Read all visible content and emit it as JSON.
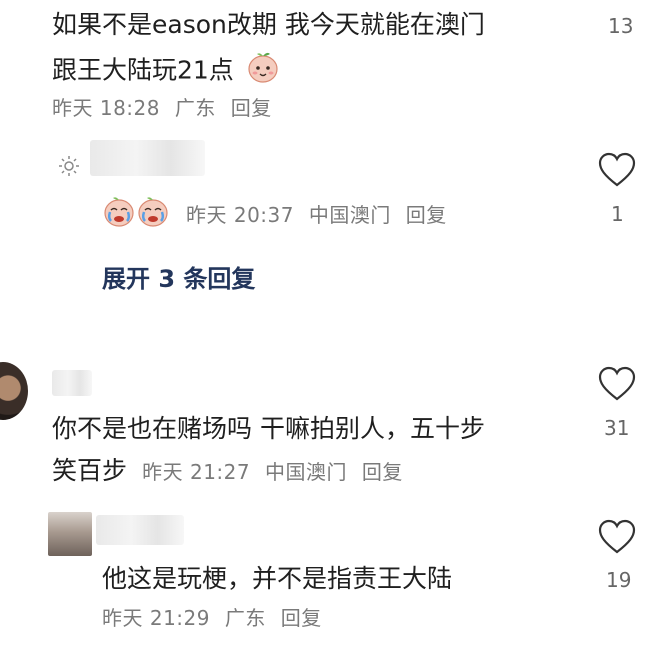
{
  "comments": [
    {
      "line1": "如果不是eason改期 我今天就能在澳门",
      "line2": "跟王大陆玩21点",
      "time": "昨天 18:28",
      "location": "广东",
      "reply_label": "回复",
      "likes": "13"
    },
    {
      "time": "昨天 20:37",
      "location": "中国澳门",
      "reply_label": "回复",
      "likes": "1"
    },
    {
      "line1": "你不是也在赌场吗 干嘛拍别人，五十步",
      "line2": "笑百步",
      "time": "昨天 21:27",
      "location": "中国澳门",
      "reply_label": "回复",
      "likes": "31"
    },
    {
      "line1": "他这是玩梗，并不是指责王大陆",
      "time": "昨天 21:29",
      "location": "广东",
      "reply_label": "回复",
      "likes": "19"
    }
  ],
  "expand_replies": "展开 3 条回复",
  "icons": {
    "heart": "heart-outline-icon",
    "sun": "sun-icon",
    "emoji_peach": "peach-face-emoji",
    "emoji_cry": "crying-face-emoji"
  },
  "colors": {
    "text": "#1f1f1f",
    "meta": "#7a7a7a",
    "expand": "#23365c"
  }
}
